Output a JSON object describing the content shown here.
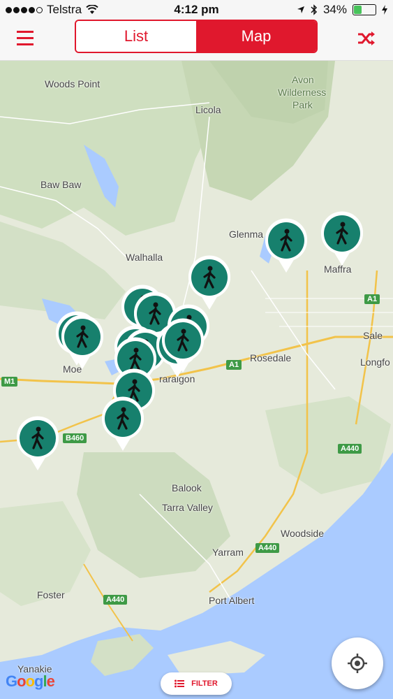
{
  "status": {
    "carrier": "Telstra",
    "time": "4:12 pm",
    "battery": "34%"
  },
  "nav": {
    "tab_list": "List",
    "tab_map": "Map",
    "active_tab": "Map"
  },
  "map": {
    "labels": {
      "woods_point": "Woods Point",
      "avon": "Avon",
      "wilderness": "Wilderness",
      "park": "Park",
      "licola": "Licola",
      "baw_baw": "Baw Baw",
      "glenmaggie": "Glenma",
      "maffra": "Maffra",
      "walhalla": "Walhalla",
      "sale": "Sale",
      "rosedale": "Rosedale",
      "longford": "Longfo",
      "moe": "Moe",
      "traralgon": "raralgon",
      "balook": "Balook",
      "tarra_valley": "Tarra Valley",
      "woodside": "Woodside",
      "yarram": "Yarram",
      "foster": "Foster",
      "port_albert": "Port Albert",
      "yanakie": "Yanakie"
    },
    "shields": {
      "a1_east": "A1",
      "a1_mid": "A1",
      "m1": "M1",
      "b460": "B460",
      "a440_east": "A440",
      "a440_mid": "A440",
      "a440_west": "A440"
    },
    "pin_icon": "walking-person-icon",
    "pin_color": "#17806d",
    "accent": "#e0182d"
  },
  "filter": {
    "label": "FILTER"
  },
  "attribution": "Google"
}
